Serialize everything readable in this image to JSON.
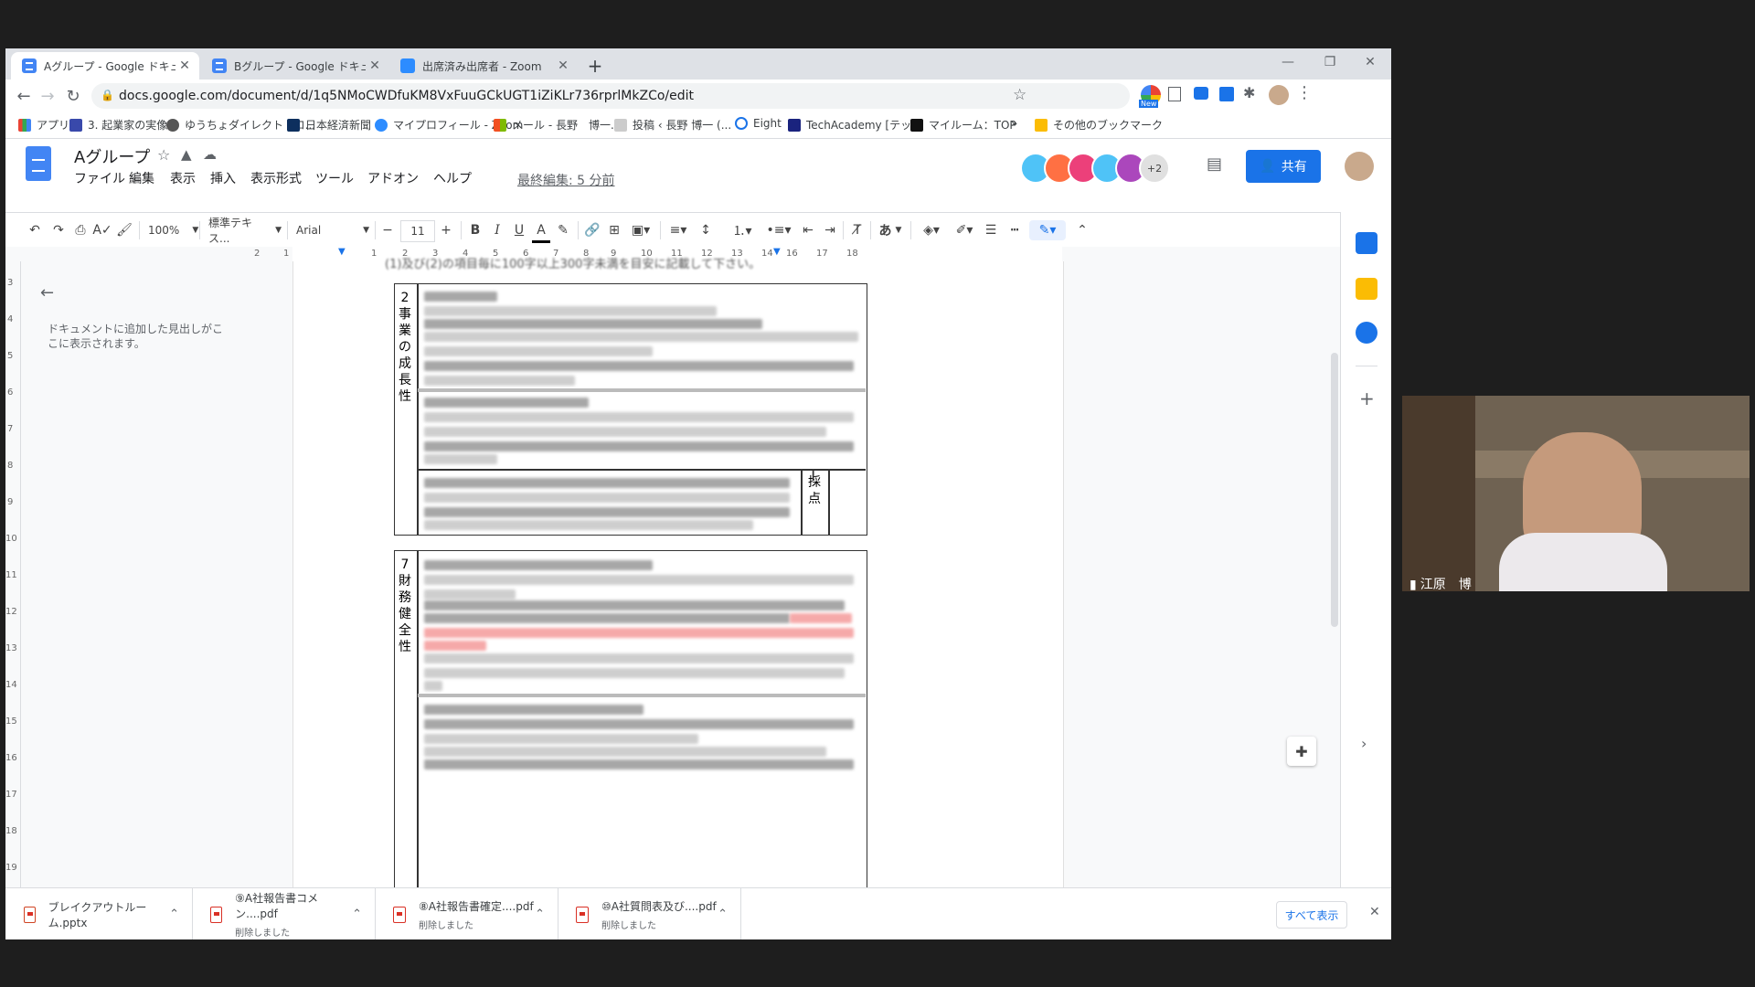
{
  "tabs": [
    {
      "label": "Aグループ - Google ドキュメント"
    },
    {
      "label": "Bグループ - Google ドキュメント"
    },
    {
      "label": "出席済み出席者 - Zoom"
    }
  ],
  "new_tab": "+",
  "window_controls": {
    "minimize": "—",
    "restore": "❐",
    "close": "✕"
  },
  "url": "docs.google.com/document/d/1q5NMoCWDfuKM8VxFuuGCkUGT1iZiKLr736rprlMkZCo/edit",
  "bookmarks": [
    "アプリ",
    "3. 起業家の実像",
    "ゆうちょダイレクト | ロ...",
    "日本経済新聞",
    "マイプロフィール - Zoom",
    "メール - 長野　博一...",
    "投稿 ‹ 長野 博一 (...",
    "Eight",
    "TechAcademy [テッ...",
    "マイルーム：TOP",
    "»",
    "その他のブックマーク"
  ],
  "badge_new": "New",
  "doc": {
    "title": "Aグループ",
    "last_edit": "最終編集: 5 分前"
  },
  "menus": [
    "ファイル",
    "編集",
    "表示",
    "挿入",
    "表示形式",
    "ツール",
    "アドオン",
    "ヘルプ"
  ],
  "collab_extra": "+2",
  "share_label": "共有",
  "toolbar": {
    "zoom": "100%",
    "style": "標準テキス...",
    "font": "Arial",
    "font_size": "11",
    "input_mode": "あ"
  },
  "ruler_ticks": [
    "2",
    "1",
    "1",
    "2",
    "3",
    "4",
    "5",
    "6",
    "7",
    "8",
    "9",
    "10",
    "11",
    "12",
    "13",
    "14",
    "15",
    "16",
    "17",
    "18"
  ],
  "vruler_ticks": [
    "3",
    "4",
    "5",
    "6",
    "7",
    "8",
    "9",
    "10",
    "11",
    "12",
    "13",
    "14",
    "15",
    "16",
    "17",
    "18",
    "19"
  ],
  "outline_text": "ドキュメントに追加した見出しがここに表示されます。",
  "top_text": "(1)及び(2)の項目毎に100字以上300字未満を目安に記載して下さい。",
  "section1_label": "2事業の成長性",
  "score_label": "採点",
  "section2_label": "7財務健全性",
  "downloads": [
    {
      "name": "ブレイクアウトルーム.pptx",
      "sub": ""
    },
    {
      "name": "⑨A社報告書コメン....pdf",
      "sub": "削除しました"
    },
    {
      "name": "⑧A社報告書確定....pdf",
      "sub": "削除しました"
    },
    {
      "name": "⑩A社質問表及び....pdf",
      "sub": "削除しました"
    }
  ],
  "show_all": "すべて表示",
  "participant_name": "江原　博"
}
